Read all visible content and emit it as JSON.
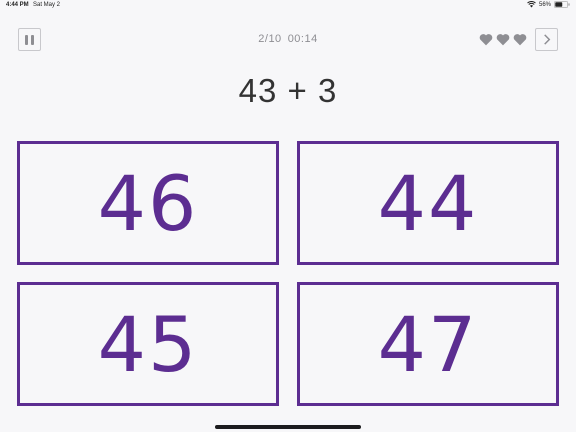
{
  "status_bar": {
    "time": "4:44 PM",
    "date": "Sat May 2",
    "battery_percent": "56%",
    "icons": [
      "wifi-icon",
      "battery-icon"
    ]
  },
  "header": {
    "progress": "2/10",
    "timer": "00:14",
    "lives_remaining": 3,
    "icons": [
      "pause-icon",
      "heart-icon",
      "chevron-right-icon"
    ]
  },
  "question": {
    "text": "43 + 3"
  },
  "answers": [
    "46",
    "44",
    "45",
    "47"
  ],
  "colors": {
    "accent": "#5c2d91",
    "background": "#f7f7f9",
    "muted": "#8e8e93",
    "text": "#333333"
  }
}
